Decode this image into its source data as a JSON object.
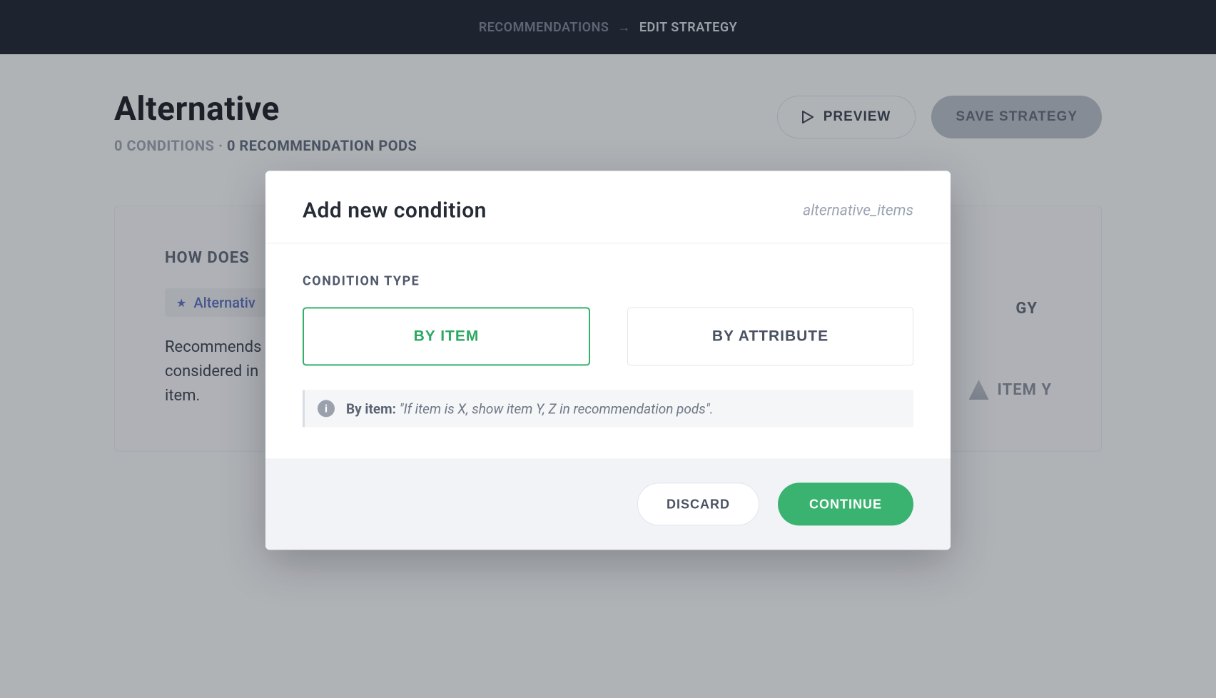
{
  "breadcrumb": {
    "parent": "RECOMMENDATIONS",
    "current": "EDIT STRATEGY"
  },
  "header": {
    "title": "Alternative",
    "conditions_count": "0 CONDITIONS",
    "separator": "·",
    "pods_count": "0 RECOMMENDATION PODS",
    "preview_label": "PREVIEW",
    "save_label": "SAVE STRATEGY"
  },
  "card": {
    "question_suffix": "GY",
    "question_prefix": "HOW DOES",
    "chip_label": "Alternativ",
    "body_prefix": "Recommends",
    "body_line2": "considered in",
    "body_line3": "item.",
    "item_y_label": "ITEM Y"
  },
  "modal": {
    "title": "Add new condition",
    "slug": "alternative_items",
    "condition_type_label": "CONDITION TYPE",
    "option_by_item": "BY ITEM",
    "option_by_attribute": "BY ATTRIBUTE",
    "info_prefix": "By item:",
    "info_example": "\"If item is X, show item Y, Z in recommendation pods\".",
    "discard_label": "DISCARD",
    "continue_label": "CONTINUE"
  }
}
